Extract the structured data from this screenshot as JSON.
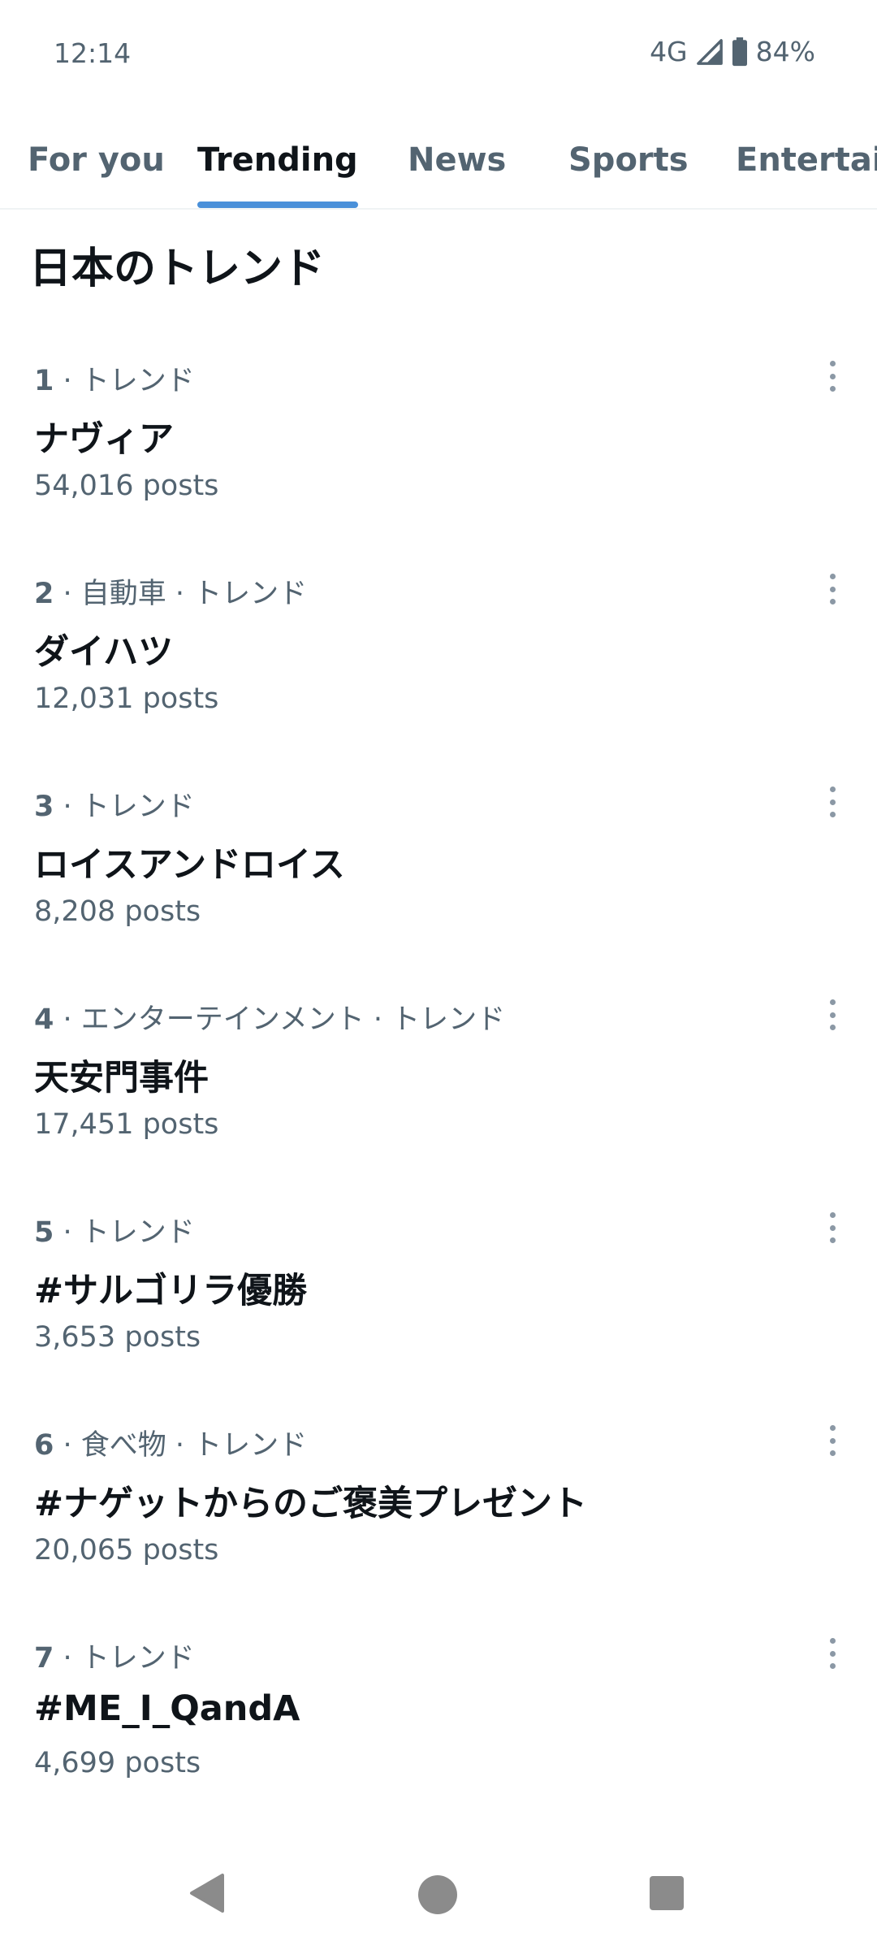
{
  "status_bar": {
    "time": "12:14",
    "network": "4G",
    "battery": "84%",
    "icons": [
      "signal-icon",
      "battery-icon"
    ]
  },
  "tabs": [
    {
      "label": "For you",
      "active": false
    },
    {
      "label": "Trending",
      "active": true
    },
    {
      "label": "News",
      "active": false
    },
    {
      "label": "Sports",
      "active": false
    },
    {
      "label": "Entertainment",
      "active": false
    }
  ],
  "section_title": "日本のトレンド",
  "trends": [
    {
      "rank": "1",
      "context": "· トレンド",
      "name": "ナヴィア",
      "posts": "54,016 posts"
    },
    {
      "rank": "2",
      "context": "· 自動車 · トレンド",
      "name": "ダイハツ",
      "posts": "12,031 posts"
    },
    {
      "rank": "3",
      "context": "· トレンド",
      "name": "ロイスアンドロイス",
      "posts": "8,208 posts"
    },
    {
      "rank": "4",
      "context": "· エンターテインメント · トレンド",
      "name": "天安門事件",
      "posts": "17,451 posts"
    },
    {
      "rank": "5",
      "context": "· トレンド",
      "name": "#サルゴリラ優勝",
      "posts": "3,653 posts"
    },
    {
      "rank": "6",
      "context": "· 食べ物 · トレンド",
      "name": "#ナゲットからのご褒美プレゼント",
      "posts": "20,065 posts"
    },
    {
      "rank": "7",
      "context": "· トレンド",
      "name": "#ME_I_QandA",
      "posts": "4,699 posts"
    }
  ],
  "colors": {
    "accent": "#4a90d9",
    "text_primary": "#0f1419",
    "text_secondary": "#536471"
  },
  "nav_icons": [
    "back-icon",
    "home-icon",
    "recents-icon"
  ]
}
